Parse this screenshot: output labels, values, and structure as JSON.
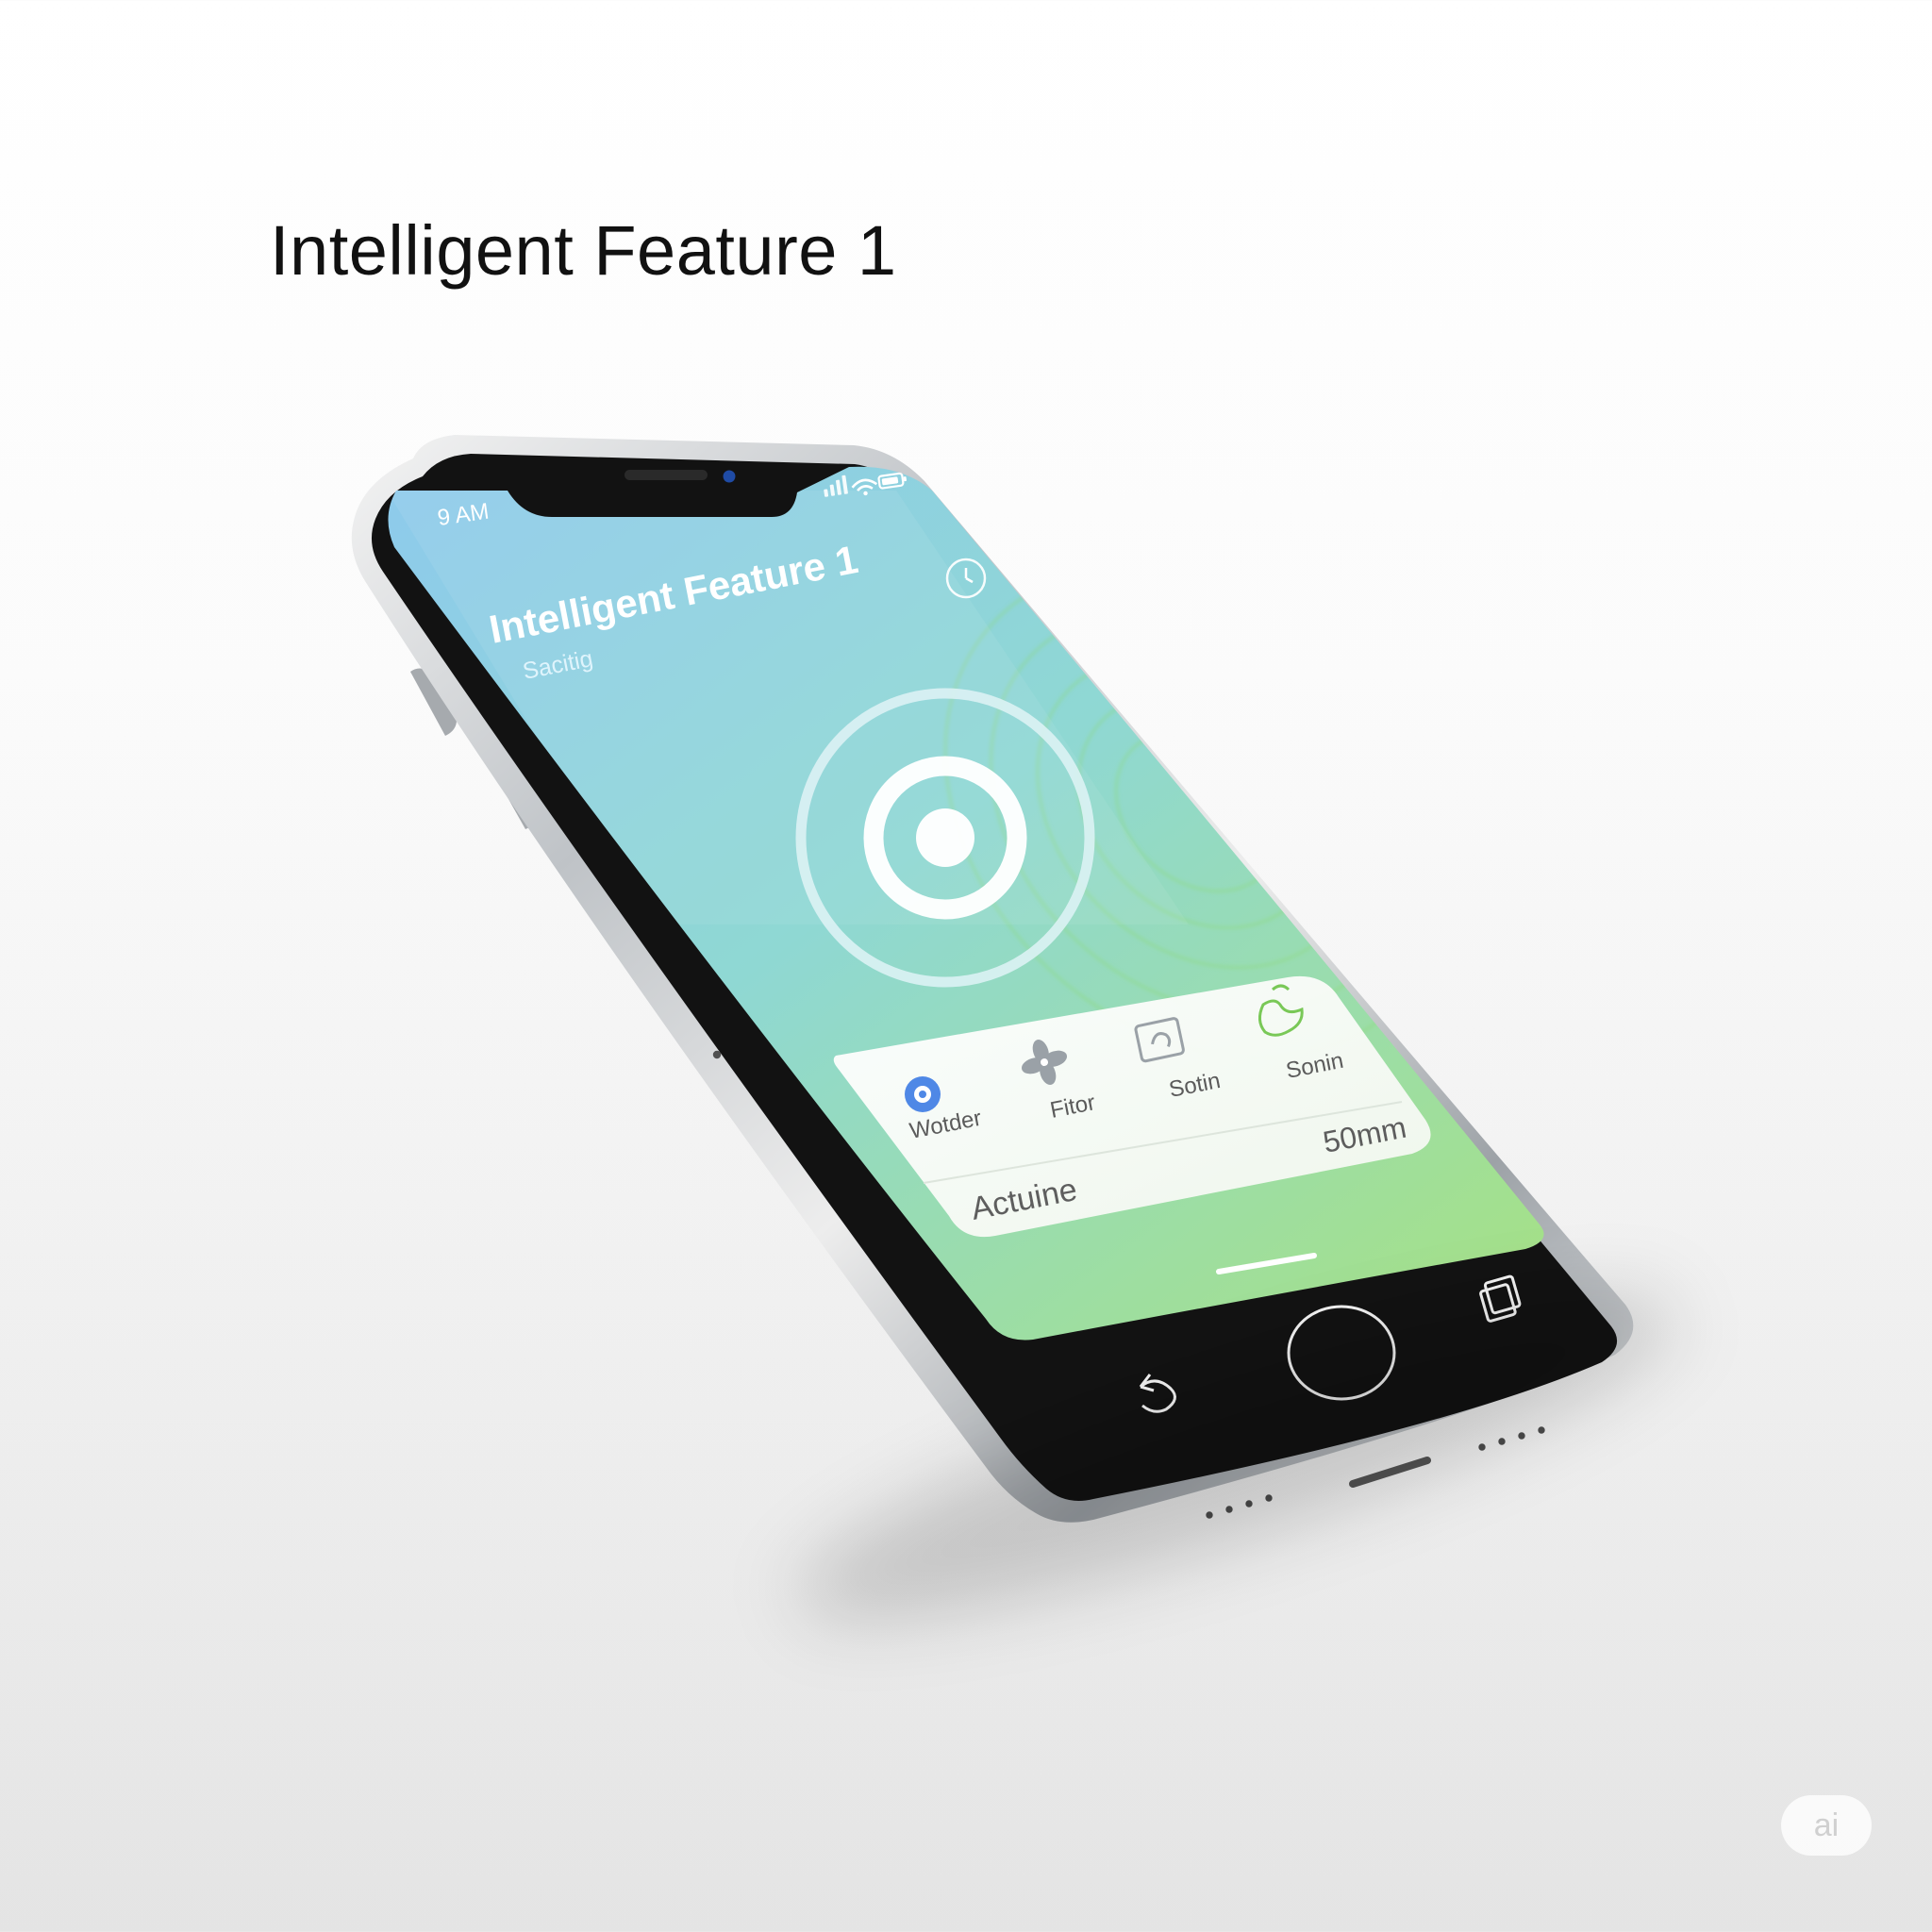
{
  "page": {
    "headline": "Intelligent Feature 1"
  },
  "phone": {
    "status_bar": {
      "time": "9 AM",
      "signal_icon": "signal-bars-icon",
      "wifi_icon": "wifi-icon",
      "battery_icon": "battery-icon"
    },
    "screen": {
      "title": "Intelligent Feature 1",
      "subtitle": "Sacitig",
      "timer_icon": "timer-icon",
      "scan_icon": "target-icon"
    },
    "feature_card": {
      "items": [
        {
          "label": "Wotder",
          "icon": "settings-badge-icon"
        },
        {
          "label": "Fitor",
          "icon": "fan-icon"
        },
        {
          "label": "Sotin",
          "icon": "square-loop-icon"
        },
        {
          "label": "Sonin",
          "icon": "leaf-gesture-icon"
        }
      ],
      "value": "50mm",
      "status": "Actuine"
    },
    "nav": {
      "back_icon": "back-arrow-icon",
      "home_icon": "home-button-icon",
      "multitask_icon": "stacked-pages-icon"
    }
  },
  "watermark": {
    "text": "ai"
  },
  "colors": {
    "screen_top": "#8ec9ee",
    "screen_mid": "#8fd8d3",
    "screen_bottom": "#a8e27d",
    "ring_green": "#8ad968",
    "headline": "#111111",
    "phone_frame": "#cfd2d5",
    "phone_bezel": "#121212"
  }
}
